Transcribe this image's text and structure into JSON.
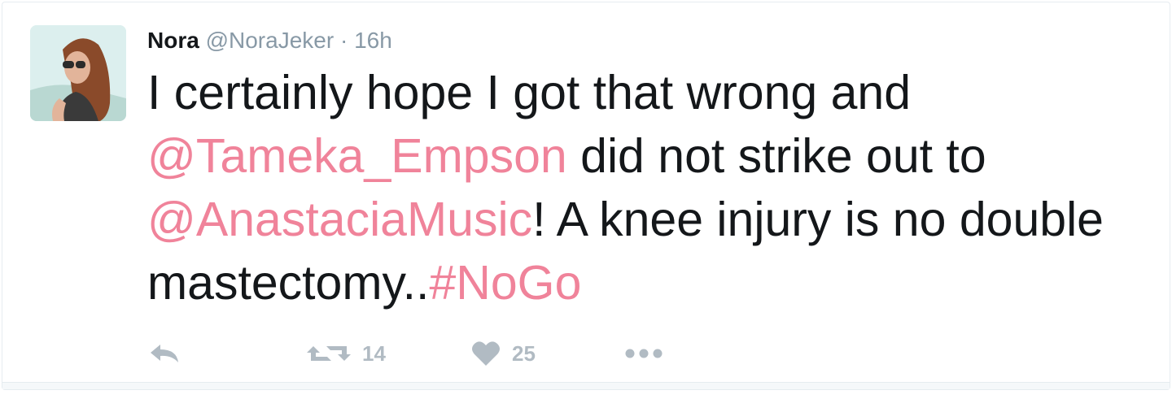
{
  "tweet": {
    "user": {
      "name": "Nora",
      "handle": "@NoraJeker",
      "separator": "·",
      "time": "16h"
    },
    "text": {
      "part1": "I certainly hope I got that wrong and ",
      "mention1": "@Tameka_Empson",
      "part2": " did not strike out to ",
      "mention2": "@AnastaciaMusic",
      "part3": "! A knee injury is no double mastectomy..",
      "hashtag": "#NoGo"
    },
    "actions": {
      "reply_icon": "reply-icon",
      "retweet_icon": "retweet-icon",
      "retweet_count": "14",
      "like_icon": "heart-icon",
      "like_count": "25",
      "more_icon": "more-icon"
    },
    "colors": {
      "link": "#f0839a",
      "muted": "#8899a6",
      "action": "#b1bbc3",
      "text": "#14171a"
    }
  }
}
